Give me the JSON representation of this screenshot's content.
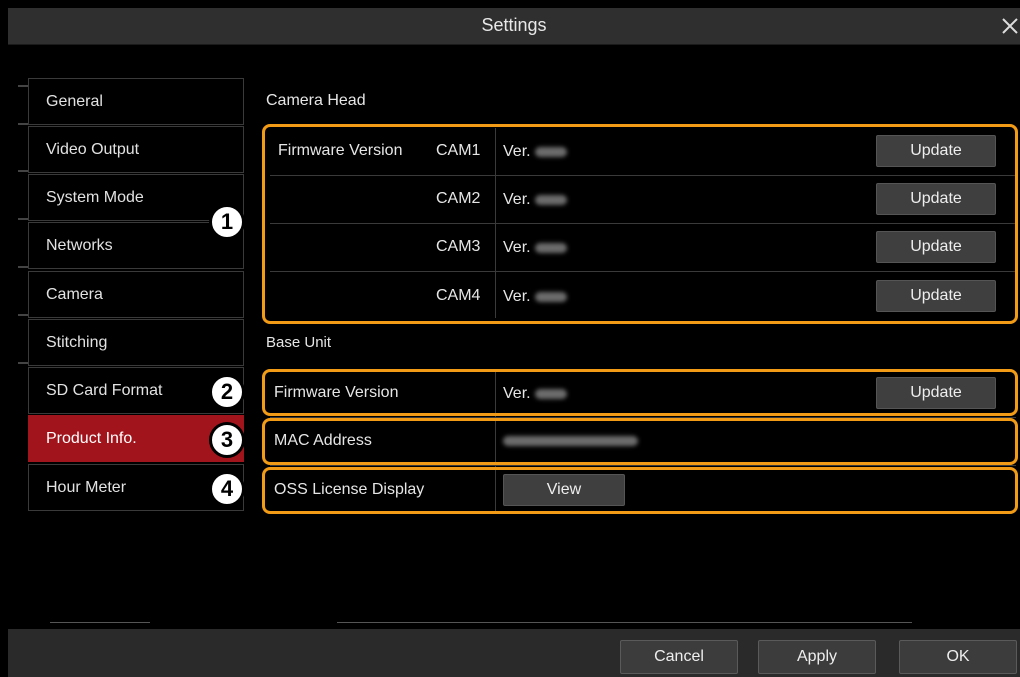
{
  "window": {
    "title": "Settings"
  },
  "sidebar": {
    "items": [
      {
        "label": "General"
      },
      {
        "label": "Video Output"
      },
      {
        "label": "System Mode"
      },
      {
        "label": "Networks"
      },
      {
        "label": "Camera"
      },
      {
        "label": "Stitching"
      },
      {
        "label": "SD Card Format"
      },
      {
        "label": "Product Info."
      },
      {
        "label": "Hour Meter"
      }
    ],
    "active_index": 7
  },
  "callouts": [
    "1",
    "2",
    "3",
    "4"
  ],
  "camera_head": {
    "title": "Camera Head",
    "firmware_label": "Firmware Version",
    "cams": [
      {
        "name": "CAM1",
        "ver_prefix": "Ver.",
        "update": "Update"
      },
      {
        "name": "CAM2",
        "ver_prefix": "Ver.",
        "update": "Update"
      },
      {
        "name": "CAM3",
        "ver_prefix": "Ver.",
        "update": "Update"
      },
      {
        "name": "CAM4",
        "ver_prefix": "Ver.",
        "update": "Update"
      }
    ]
  },
  "base_unit": {
    "title": "Base Unit",
    "firmware_label": "Firmware Version",
    "ver_prefix": "Ver.",
    "update": "Update",
    "mac_label": "MAC Address",
    "oss_label": "OSS License Display",
    "view": "View"
  },
  "footer": {
    "cancel": "Cancel",
    "apply": "Apply",
    "ok": "OK"
  },
  "colors": {
    "active": "#a1141c",
    "highlight": "#f29b17"
  }
}
